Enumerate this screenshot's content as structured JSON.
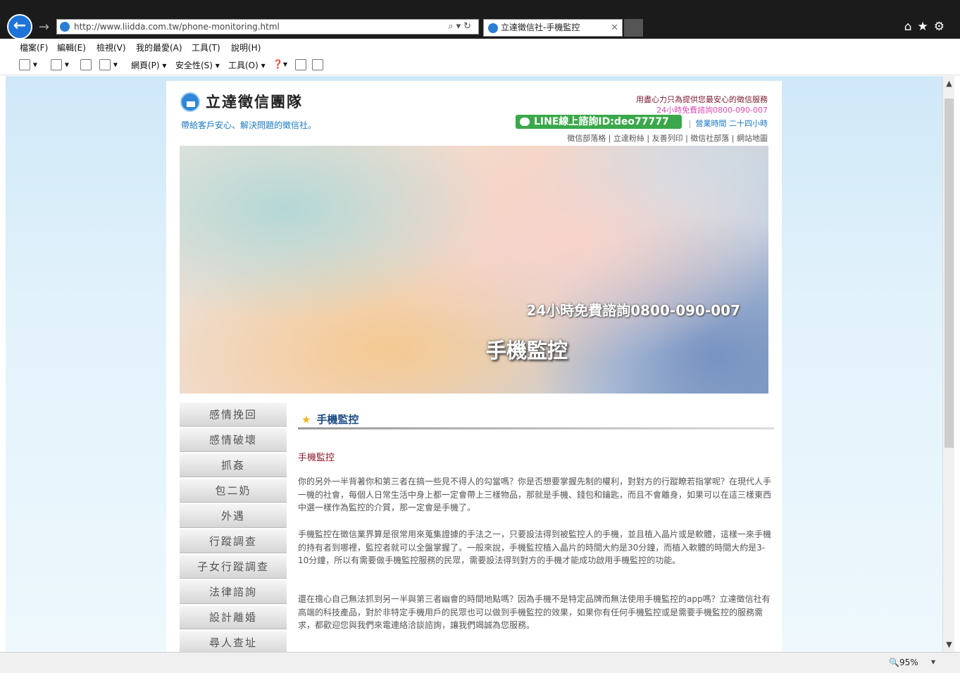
{
  "browser": {
    "address": "http://www.liidda.com.tw/phone-monitoring.html",
    "tab_title": "立達徵信社-手機監控",
    "menu": [
      "檔案(F)",
      "編輯(E)",
      "檢視(V)",
      "我的最愛(A)",
      "工具(T)",
      "說明(H)"
    ],
    "cmd": {
      "page": "網頁(P)",
      "safety": "安全性(S)",
      "tools": "工具(O)"
    },
    "zoom": "95%"
  },
  "site": {
    "name": "立達徵信團隊",
    "tagline": "帶給客戶安心、解決問題的徵信社。",
    "header_right_1": "用盡心力只為提供您最安心的徵信服務",
    "header_right_2": "24小時免費諮詢0800-090-007",
    "line_button": "LINE線上諮詢ID:deo77777",
    "hours_label": "營業時間 二十四小時",
    "top_links": "徵信部落格 | 立達粉絲 | 友善列印 | 徵信社部落 | 網站地圖"
  },
  "banner": {
    "phone_line": "24小時免費諮詢0800-090-007",
    "title": "手機監控"
  },
  "side_menu": [
    "感情挽回",
    "感情破壞",
    "抓姦",
    "包二奶",
    "外遇",
    "行蹤調查",
    "子女行蹤調查",
    "法律諮詢",
    "設計離婚",
    "尋人查址"
  ],
  "content": {
    "title": "手機監控",
    "subtitle": "手機監控",
    "p1": "你的另外一半背著你和第三者在搞一些見不得人的勾當嗎？你是否想要掌握先制的權利，對對方的行蹤瞭若指掌呢？在現代人手一機的社會，每個人日常生活中身上都一定會帶上三樣物品，那就是手機、錢包和鑰匙，而且不會離身，如果可以在這三樣東西中選一樣作為監控的介質，那一定會是手機了。",
    "p2": "手機監控在徵信業界算是很常用來蒐集證據的手法之一，只要設法得到被監控人的手機，並且植入晶片或是軟體，這樣一來手機的持有者到哪裡，監控者就可以全盤掌握了。一般來說，手機監控植入晶片的時間大約是30分鐘，而植入軟體的時間大約是3-10分鐘，所以有需要做手機監控服務的民眾，需要設法得到對方的手機才能成功啟用手機監控的功能。",
    "p3": "還在擔心自己無法抓到另一半與第三者幽會的時間地點嗎？因為手機不是特定品牌而無法使用手機監控的app嗎？立達徵信社有高端的科技產品，對於非特定手機用戶的民眾也可以做到手機監控的效果，如果你有任何手機監控或是需要手機監控的服務需求，都歡迎您與我們來電連絡洽談諮詢，讓我們竭誠為您服務。"
  }
}
